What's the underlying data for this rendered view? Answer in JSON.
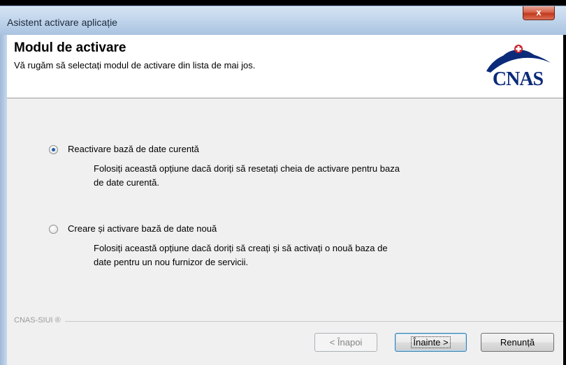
{
  "window": {
    "title": "Asistent activare aplicație",
    "close_label": "x"
  },
  "header": {
    "title": "Modul de activare",
    "subtitle": "Vă rugăm să selectați modul de activare din lista de mai jos.",
    "logo_text": "CNAS"
  },
  "options": [
    {
      "label": "Reactivare bază de date curentă",
      "desc_line1": "Folosiți această opțiune dacă doriți să resetați cheia de activare pentru baza",
      "desc_line2": "de date curentă.",
      "selected": true
    },
    {
      "label": "Creare și activare bază de date nouă",
      "desc_line1": "Folosiți această opțiune dacă doriți să creați și să activați o nouă baza de",
      "desc_line2": "date pentru un nou furnizor de servicii.",
      "selected": false
    }
  ],
  "footer": {
    "brand": "CNAS-SIUI ®",
    "back_label": "< Înapoi",
    "next_label": "Înainte >",
    "cancel_label": "Renunță"
  },
  "colors": {
    "accent": "#1d5fa8",
    "logo": "#0b2a7a",
    "close": "#c4381c"
  }
}
